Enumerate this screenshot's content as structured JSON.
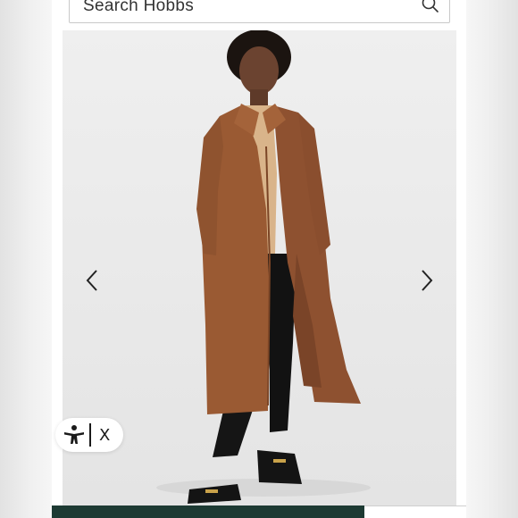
{
  "search": {
    "placeholder": "Search Hobbs",
    "icon": "search-icon"
  },
  "product_image": {
    "description_icon": "product-photo"
  },
  "carousel": {
    "prev_icon": "chevron-left-icon",
    "next_icon": "chevron-right-icon"
  },
  "accessibility_widget": {
    "icon": "accessibility-icon",
    "close_label": "X"
  },
  "colors": {
    "bottom_bar": "#1d3a33",
    "coat": "#9a5a33"
  }
}
